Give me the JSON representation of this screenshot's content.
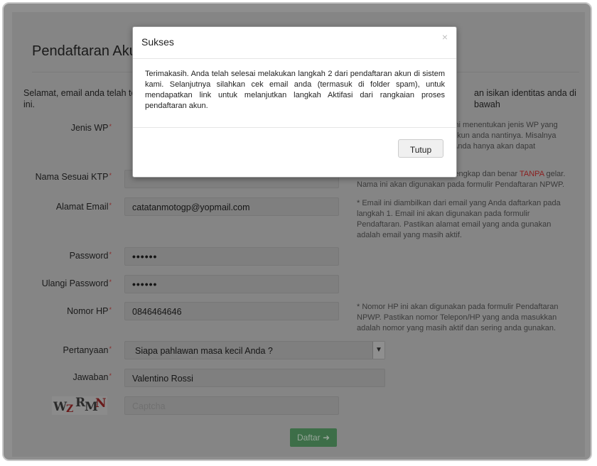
{
  "form": {
    "title": "Pendaftaran Akun",
    "intro_left": "Selamat, email anda telah terv",
    "intro_left_line2": "ini.",
    "intro_right": "an isikan identitas anda di bawah",
    "labels": {
      "jenis_wp": "Jenis WP",
      "nama": "Nama Sesuai KTP",
      "email": "Alamat Email",
      "password": "Password",
      "ulangi_password": "Ulangi Password",
      "nomor_hp": "Nomor HP",
      "pertanyaan": "Pertanyaan",
      "jawaban": "Jawaban"
    },
    "required_mark": "*",
    "values": {
      "email": "catatanmotogp@yopmail.com",
      "password": "••••••",
      "ulangi_password": "••••••",
      "nomor_hp": "0846464646",
      "pertanyaan": "Siapa pahlawan masa kecil Anda ?",
      "jawaban": "Valentino Rossi"
    },
    "captcha_placeholder": "Captcha",
    "captcha_text": [
      "W",
      "Z",
      "R",
      "M",
      "N"
    ],
    "submit_label": "Daftar",
    "submit_icon": "arrow-circle-right-icon",
    "notes": {
      "jenis_wp": [
        "ini menentukan jenis WP yang",
        "akun anda nantinya. Misalnya",
        "Anda hanya akan dapat"
      ],
      "nama_part1": "lengkap dan benar ",
      "nama_red": "TANPA",
      "nama_part2": " gelar.",
      "nama_line2": "Nama ini akan digunakan pada formulir Pendaftaran NPWP.",
      "email": [
        "* Email ini diambilkan dari email yang Anda daftarkan pada",
        "langkah 1. Email ini akan digunakan pada formulir",
        "Pendaftaran. Pastikan alamat email yang anda gunakan",
        "adalah email yang masih aktif."
      ],
      "hp": [
        "* Nomor HP ini akan digunakan pada formulir Pendaftaran",
        "NPWP. Pastikan nomor Telepon/HP yang anda masukkan",
        "adalah nomor yang masih aktif dan sering anda gunakan."
      ]
    }
  },
  "modal": {
    "title": "Sukses",
    "close_glyph": "×",
    "body": "Terimakasih. Anda telah selesai melakukan langkah 2 dari pendaftaran akun di sistem kami. Selanjutnya silahkan cek email anda (termasuk di folder spam), untuk mendapatkan link untuk melanjutkan langkah Aktifasi dari rangkaian proses pendaftaran akun.",
    "button_label": "Tutup"
  },
  "colors": {
    "overlay": "#858585",
    "submit_bg": "#3d6e48",
    "note_red": "#8b2020"
  }
}
